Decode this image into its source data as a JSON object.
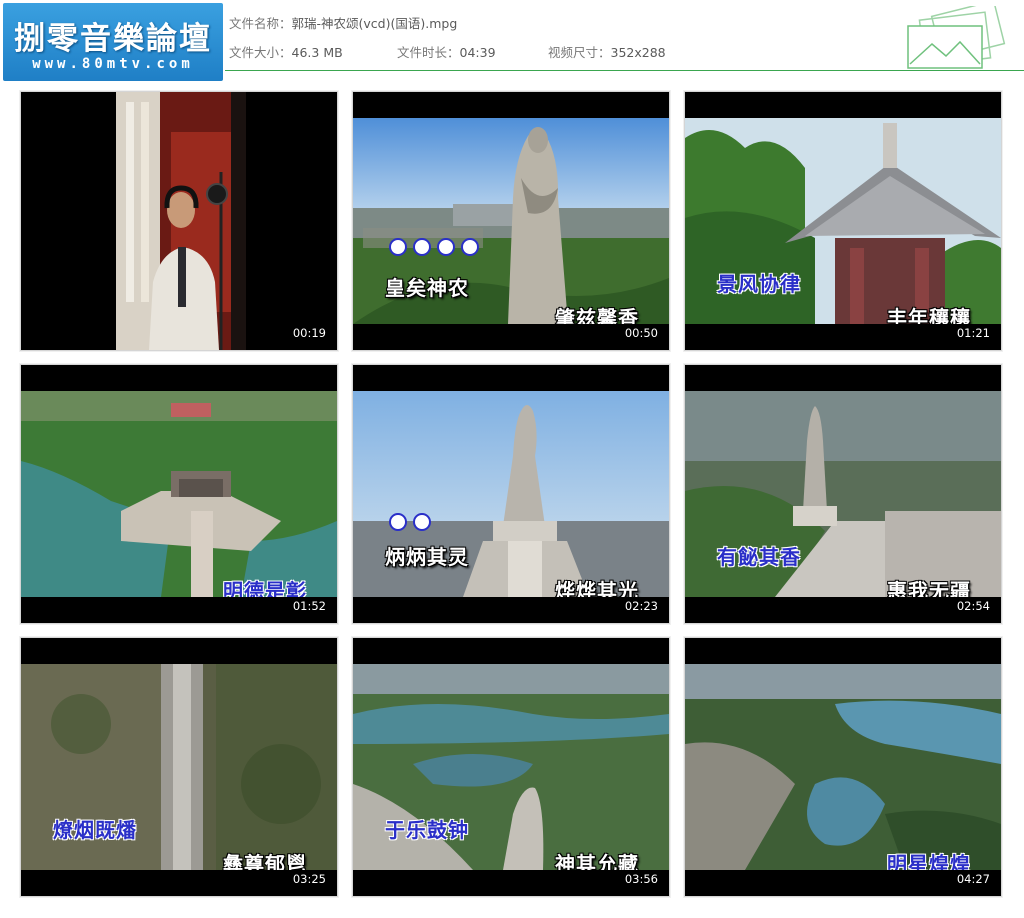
{
  "logo": {
    "title": "捌零音樂論壇",
    "url": "www.80mtv.com"
  },
  "file": {
    "name_label": "文件名称：",
    "name_value": "郭瑞-神农颂(vcd)(国语).mpg",
    "size_label": "文件大小：",
    "size_value": "46.3 MB",
    "duration_label": "文件时长：",
    "duration_value": "04:39",
    "resolution_label": "视频尺寸：",
    "resolution_value": "352x288"
  },
  "colors": {
    "accent_line": "#3aa64f",
    "logo_blue": "#2b8fd6",
    "lyric_blue": "#2a2fc8"
  },
  "thumbnails": [
    {
      "time": "00:19",
      "lyric_left": "",
      "lyric_right": ""
    },
    {
      "time": "00:50",
      "lyric_left": "皇矣神农",
      "lyric_right": "肇兹馨香",
      "dot_count": 4
    },
    {
      "time": "01:21",
      "lyric_left": "景风协律",
      "lyric_right": "丰年穰穰"
    },
    {
      "time": "01:52",
      "lyric_left": "",
      "lyric_right": "明德是彰"
    },
    {
      "time": "02:23",
      "lyric_left": "炳炳其灵",
      "lyric_right": "烨烨其光",
      "dot_count": 2
    },
    {
      "time": "02:54",
      "lyric_left": "有飶其香",
      "lyric_right": "惠我无疆"
    },
    {
      "time": "03:25",
      "lyric_left": "燎烟既燔",
      "lyric_right": "彝尊郁鬯"
    },
    {
      "time": "03:56",
      "lyric_left": "于乐鼓钟",
      "lyric_right": "神其允藏"
    },
    {
      "time": "04:27",
      "lyric_left": "",
      "lyric_right": "明星煌煌"
    }
  ]
}
